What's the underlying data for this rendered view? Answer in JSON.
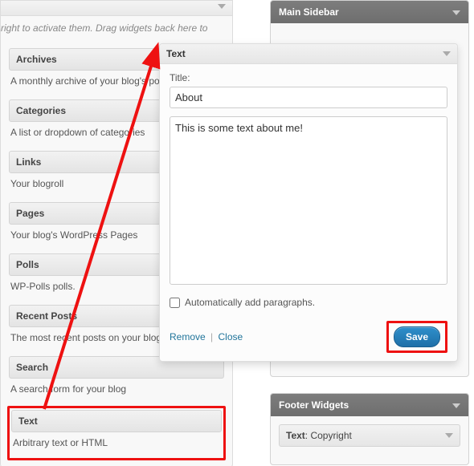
{
  "drag_hint": "right to activate them. Drag widgets back here to",
  "available_widgets": [
    {
      "title": "Archives",
      "desc": "A monthly archive of your blog's posts"
    },
    {
      "title": "Categories",
      "desc": "A list or dropdown of categories"
    },
    {
      "title": "Links",
      "desc": "Your blogroll"
    },
    {
      "title": "Pages",
      "desc": "Your blog's WordPress Pages"
    },
    {
      "title": "Polls",
      "desc": "WP-Polls polls."
    },
    {
      "title": "Recent Posts",
      "desc": "The most recent posts on your blog"
    },
    {
      "title": "Search",
      "desc": "A search form for your blog"
    }
  ],
  "text_widget_available": {
    "title": "Text",
    "desc": "Arbitrary text or HTML"
  },
  "main_sidebar": {
    "title": "Main Sidebar"
  },
  "footer_sidebar": {
    "title": "Footer Widgets",
    "item_label": "Text",
    "item_value": "Copyright"
  },
  "text_panel": {
    "head": "Text",
    "title_label": "Title:",
    "title_value": "About",
    "content_value": "This is some text about me!",
    "auto_para_label": "Automatically add paragraphs.",
    "remove": "Remove",
    "close": "Close",
    "save": "Save"
  }
}
